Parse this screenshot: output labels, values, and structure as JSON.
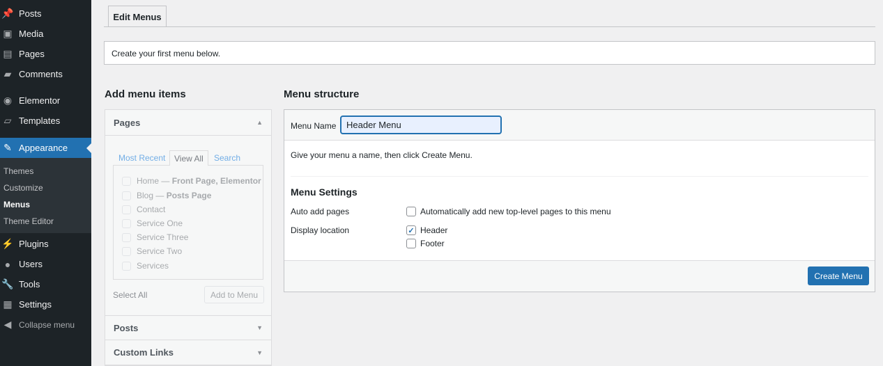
{
  "sidebar": {
    "items": [
      {
        "label": "Posts",
        "icon": "pin-icon"
      },
      {
        "label": "Media",
        "icon": "media-icon"
      },
      {
        "label": "Pages",
        "icon": "pages-icon"
      },
      {
        "label": "Comments",
        "icon": "comment-icon"
      },
      {
        "label": "Elementor",
        "icon": "elementor-icon"
      },
      {
        "label": "Templates",
        "icon": "folder-icon"
      },
      {
        "label": "Appearance",
        "icon": "brush-icon"
      },
      {
        "label": "Plugins",
        "icon": "plugin-icon"
      },
      {
        "label": "Users",
        "icon": "user-icon"
      },
      {
        "label": "Tools",
        "icon": "wrench-icon"
      },
      {
        "label": "Settings",
        "icon": "settings-icon"
      },
      {
        "label": "Collapse menu",
        "icon": "collapse-icon"
      }
    ],
    "submenu": [
      "Themes",
      "Customize",
      "Menus",
      "Theme Editor"
    ],
    "active_color": "#2271b1"
  },
  "tabs": {
    "edit_menus": "Edit Menus"
  },
  "notice": "Create your first menu below.",
  "add_items": {
    "title": "Add menu items",
    "pages": {
      "title": "Pages",
      "tabs": [
        "Most Recent",
        "View All",
        "Search"
      ],
      "items": [
        {
          "name": "Home",
          "suffix": "Front Page, Elementor"
        },
        {
          "name": "Blog",
          "suffix": "Posts Page"
        },
        {
          "name": "Contact",
          "suffix": ""
        },
        {
          "name": "Service One",
          "suffix": ""
        },
        {
          "name": "Service Three",
          "suffix": ""
        },
        {
          "name": "Service Two",
          "suffix": ""
        },
        {
          "name": "Services",
          "suffix": ""
        }
      ],
      "select_all": "Select All",
      "add_button": "Add to Menu"
    },
    "posts": "Posts",
    "custom_links": "Custom Links"
  },
  "structure": {
    "title": "Menu structure",
    "menu_name_label": "Menu Name",
    "menu_name_value": "Header Menu",
    "hint": "Give your menu a name, then click Create Menu.",
    "settings_title": "Menu Settings",
    "auto_add_label": "Auto add pages",
    "auto_add_text": "Automatically add new top-level pages to this menu",
    "auto_add_checked": false,
    "display_location_label": "Display location",
    "locations": [
      {
        "label": "Header",
        "checked": true
      },
      {
        "label": "Footer",
        "checked": false
      }
    ],
    "create_button": "Create Menu"
  }
}
